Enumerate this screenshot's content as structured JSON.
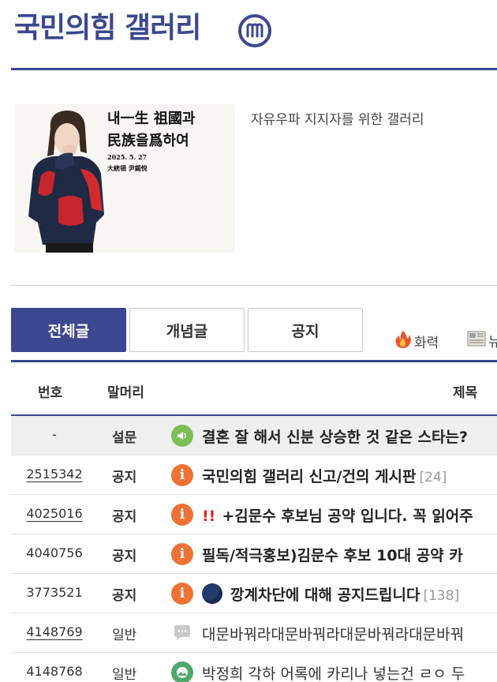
{
  "header": {
    "title": "국민의힘 갤러리",
    "badge_letter": "m"
  },
  "intro": {
    "banner_text": {
      "line1": "내一生 祖國과",
      "line2": "民族을爲하여",
      "date": "2025. 5. 27",
      "sign": "大統領 尹錫悅"
    },
    "description": "자유우파 지지자를 위한 갤러리"
  },
  "tabs": [
    {
      "label": "전체글",
      "active": true
    },
    {
      "label": "개념글",
      "active": false
    },
    {
      "label": "공지",
      "active": false
    }
  ],
  "quick_links": {
    "fire": "화력",
    "news": "뉴"
  },
  "table": {
    "columns": {
      "num": "번호",
      "head": "말머리",
      "title": "제목"
    },
    "rows": [
      {
        "num": "-",
        "head": "설문",
        "icon": "speaker-icon",
        "title": "결혼 잘 해서 신분 상승한 것 같은 스타는?",
        "prefix": "",
        "reply": ""
      },
      {
        "num": "2515342",
        "head": "공지",
        "icon": "notice-icon",
        "title": "국민의힘 갤러리 신고/건의 게시판",
        "prefix": "",
        "reply": "[24]"
      },
      {
        "num": "4025016",
        "head": "공지",
        "icon": "notice-icon",
        "title": "+김문수 후보님 공약 입니다. 꼭 읽어주",
        "prefix": "!!",
        "reply": ""
      },
      {
        "num": "4040756",
        "head": "공지",
        "icon": "notice-icon",
        "title": "필독/적극홍보)김문수 후보 10대 공약 카",
        "prefix": "",
        "reply": ""
      },
      {
        "num": "3773521",
        "head": "공지",
        "icon": "notice-icon",
        "title": "깡계차단에 대해 공지드립니다",
        "prefix": "",
        "reply": "[138]"
      },
      {
        "num": "4148769",
        "head": "일반",
        "icon": "speech-bubble-icon",
        "title": "대문바꿔라대문바꿔라대문바꿔라대문바꿔",
        "prefix": "",
        "reply": ""
      },
      {
        "num": "4148768",
        "head": "일반",
        "icon": "image-icon",
        "title": "박정희 각하 어록에 카리나 넣는건 ㄹㅇ 두",
        "prefix": "",
        "reply": ""
      }
    ]
  },
  "colors": {
    "brand": "#3b4890",
    "notice_icon": "#ee7236",
    "survey_icon": "#7bbf58",
    "image_icon": "#4ea86b",
    "alert": "#e02121"
  }
}
